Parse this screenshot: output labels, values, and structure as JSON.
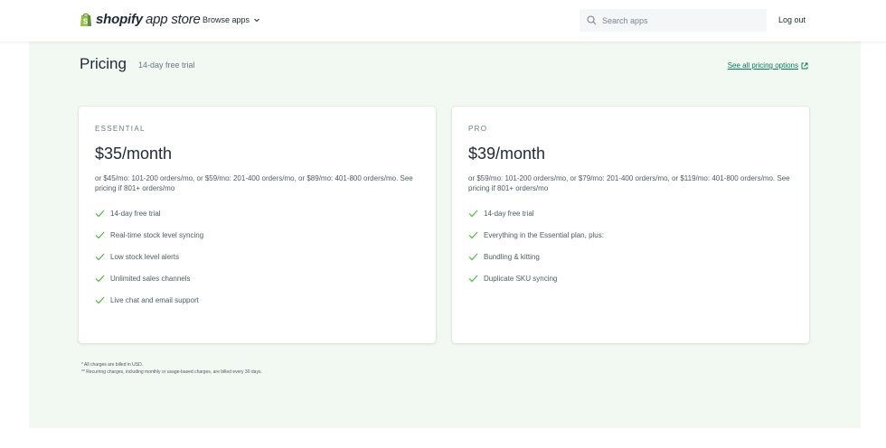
{
  "header": {
    "logo_brand": "shopify",
    "logo_suffix": "app store",
    "browse_label": "Browse apps",
    "search_placeholder": "Search apps",
    "logout_label": "Log out"
  },
  "pricing": {
    "title": "Pricing",
    "subtitle": "14-day free trial",
    "all_options_label": "See all pricing options"
  },
  "plans": [
    {
      "name": "ESSENTIAL",
      "price": "$35/month",
      "note": "or $45/mo: 101-200 orders/mo, or $59/mo: 201-400 orders/mo, or $89/mo: 401-800 orders/mo. See pricing if 801+ orders/mo",
      "features": [
        "14-day free trial",
        "Real-time stock level syncing",
        "Low stock level alerts",
        "Unlimited sales channels",
        "Live chat and email support"
      ]
    },
    {
      "name": "PRO",
      "price": "$39/month",
      "note": "or $59/mo: 101-200 orders/mo, or $79/mo: 201-400 orders/mo, or $119/mo: 401-800 orders/mo. See pricing if 801+ orders/mo",
      "features": [
        "14-day free trial",
        "Everything in the Essential plan, plus:",
        "Bundling & kitting",
        "Duplicate SKU syncing"
      ]
    }
  ],
  "footnotes": [
    "* All charges are billed in USD.",
    "** Recurring charges, including monthly or usage-based charges, are billed every 30 days."
  ],
  "colors": {
    "panel_bg": "#f1f9f2",
    "brand_green": "#95bf47",
    "link_green": "#007a5a",
    "check_green": "#50b83c"
  }
}
